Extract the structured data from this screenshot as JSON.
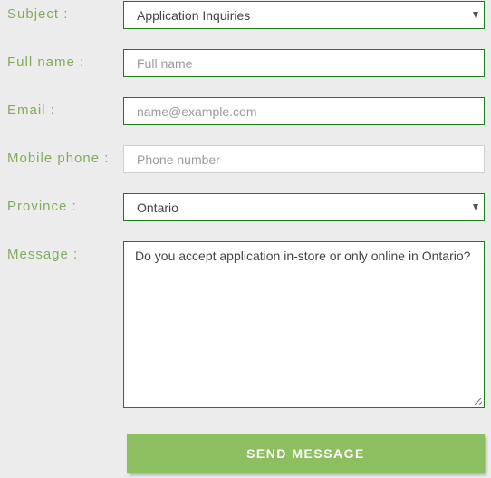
{
  "form": {
    "subject": {
      "label": "Subject :",
      "value": "Application Inquiries"
    },
    "full_name": {
      "label": "Full name :",
      "placeholder": "Full name"
    },
    "email": {
      "label": "Email :",
      "placeholder": "name@example.com"
    },
    "mobile_phone": {
      "label": "Mobile phone :",
      "placeholder": "Phone number"
    },
    "province": {
      "label": "Province :",
      "value": "Ontario"
    },
    "message": {
      "label": "Message :",
      "value": "Do you accept application in-store or only online in Ontario?"
    },
    "submit_label": "SEND MESSAGE"
  },
  "colors": {
    "label": "#7fae5a",
    "border_active": "#1e7d1e",
    "button": "#8dbf61",
    "background": "#ececec"
  }
}
